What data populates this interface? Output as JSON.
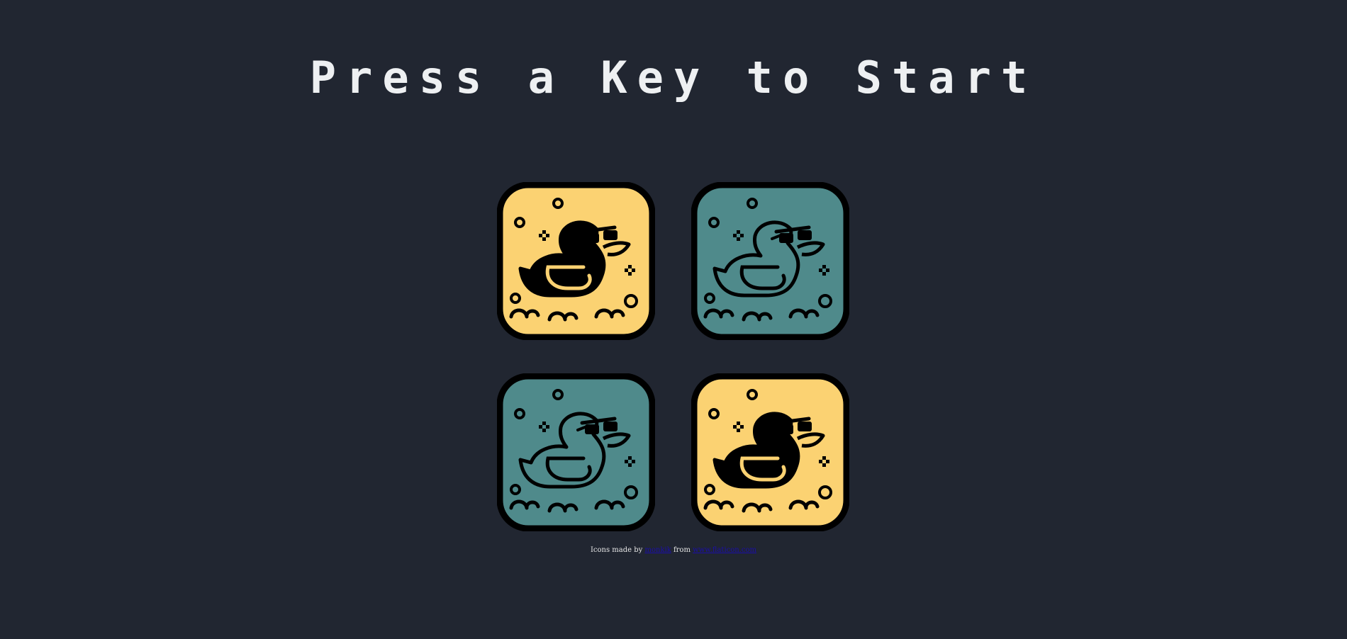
{
  "title": "Press a Key to Start",
  "colors": {
    "background": "#212631",
    "title": "#eef0f2",
    "tile_yellow": "#fbd272",
    "tile_teal": "#4f8a8b",
    "outline": "#000000",
    "link": "#1a0dab"
  },
  "tiles": [
    {
      "variant": "yellow",
      "icon": "duck-with-sunglasses-icon"
    },
    {
      "variant": "teal",
      "icon": "duck-with-sunglasses-icon"
    },
    {
      "variant": "teal",
      "icon": "duck-with-sunglasses-icon"
    },
    {
      "variant": "yellow",
      "icon": "duck-with-sunglasses-icon"
    }
  ],
  "credit": {
    "prefix": "Icons made by",
    "author": "monkik",
    "middle": "from",
    "site": "www.flaticon.com"
  }
}
